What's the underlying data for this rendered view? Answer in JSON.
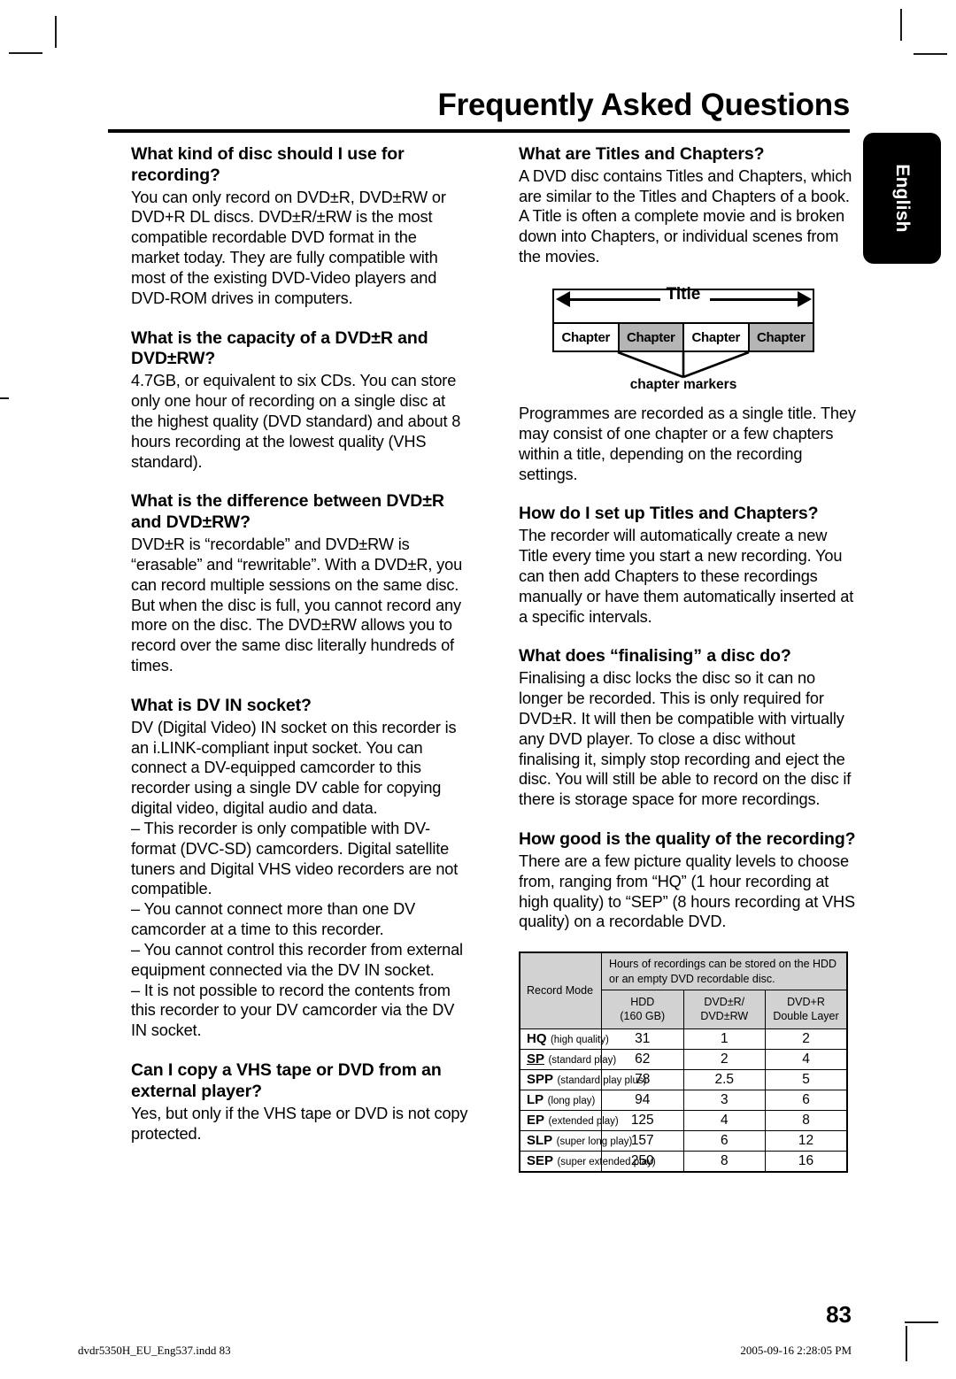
{
  "header": {
    "title": "Frequently Asked Questions",
    "language_tab": "English"
  },
  "left_column": {
    "sections": [
      {
        "question": "What kind of disc should I use for recording?",
        "answer": "You can only record on DVD±R, DVD±RW or DVD+R DL discs. DVD±R/±RW is the most compatible recordable DVD format in the market today. They are fully compatible with most of the existing DVD-Video players and DVD-ROM drives in computers."
      },
      {
        "question": "What is the capacity of a DVD±R and DVD±RW?",
        "answer": "4.7GB, or equivalent to six CDs. You can store only one hour of recording on a single disc at the highest quality (DVD standard) and about 8 hours recording at the lowest quality (VHS standard)."
      },
      {
        "question": "What is the difference between DVD±R and DVD±RW?",
        "answer": "DVD±R is “recordable” and DVD±RW is “erasable” and “rewritable”. With a DVD±R, you can record multiple sessions on the same disc. But when the disc is full, you cannot record any more on the disc. The DVD±RW allows you to record over the same disc literally hundreds of times."
      },
      {
        "question": "What is DV IN socket?",
        "answer": "DV (Digital Video) IN socket on this recorder is an i.LINK-compliant input socket. You can connect a DV-equipped camcorder to this recorder using a single DV cable for copying digital video, digital audio and data.",
        "dashes": [
          "–  This recorder is only compatible with DV-format (DVC-SD) camcorders. Digital satellite tuners and Digital VHS video recorders are not compatible.",
          "–  You cannot connect more than one DV camcorder at a time to this recorder.",
          "–  You cannot control this recorder from external equipment connected via the DV IN socket.",
          "–  It is not possible to record the contents from this recorder to your DV camcorder via the DV IN socket."
        ]
      },
      {
        "question": "Can I copy a VHS tape or DVD from an external player?",
        "answer": "Yes, but only if the VHS tape or DVD is not copy protected."
      }
    ]
  },
  "right_column": {
    "sections": [
      {
        "question": "What are Titles and Chapters?",
        "answer": "A DVD disc contains Titles and Chapters, which are similar to the Titles and Chapters of a book.  A Title is often a complete movie and is broken down into Chapters, or individual scenes from the movies."
      },
      {
        "answer": "Programmes are recorded as a single title. They may consist of one chapter or a few chapters within a title, depending on the recording settings."
      },
      {
        "question": "How do I set up Titles and Chapters?",
        "answer": "The recorder will automatically create a new Title every time you start a new recording. You can then add Chapters to these recordings manually or have them automatically inserted at a specific intervals."
      },
      {
        "question": "What does “finalising” a disc do?",
        "answer": "Finalising a disc locks the disc so it can no longer be recorded. This is only required for DVD±R. It will then be compatible with virtually any DVD player. To close a disc without finalising it, simply stop recording and eject the disc. You will still be able to record on the disc if there is storage space for more recordings."
      },
      {
        "question": "How good is the quality of the recording?",
        "answer": "There are a few picture quality levels to choose from, ranging from “HQ” (1 hour recording at high quality) to “SEP” (8 hours recording at VHS quality) on a recordable DVD."
      }
    ]
  },
  "diagram": {
    "title_label": "Title",
    "chapters": [
      "Chapter",
      "Chapter",
      "Chapter",
      "Chapter"
    ],
    "markers_label": "chapter markers"
  },
  "record_table": {
    "col_record_mode": "Record Mode",
    "col_hours_header": "Hours of recordings can be stored on the HDD or an empty DVD recordable disc.",
    "subheaders": [
      "HDD\n(160 GB)",
      "DVD±R/\nDVD±RW",
      "DVD+R\nDouble Layer"
    ],
    "sub_hdd_line1": "HDD",
    "sub_hdd_line2": "(160 GB)",
    "sub_dvdr_line1": "DVD±R/",
    "sub_dvdr_line2": "DVD±RW",
    "sub_dl_line1": "DVD+R",
    "sub_dl_line2": "Double Layer",
    "rows": [
      {
        "abbr": "HQ",
        "full": "(high quality)",
        "hdd": "31",
        "dvd": "1",
        "dl": "2",
        "underline": false
      },
      {
        "abbr": "SP",
        "full": "(standard play)",
        "hdd": "62",
        "dvd": "2",
        "dl": "4",
        "underline": true
      },
      {
        "abbr": "SPP",
        "full": "(standard play plus)",
        "hdd": "78",
        "dvd": "2.5",
        "dl": "5",
        "underline": false
      },
      {
        "abbr": "LP",
        "full": "(long play)",
        "hdd": "94",
        "dvd": "3",
        "dl": "6",
        "underline": false
      },
      {
        "abbr": "EP",
        "full": "(extended play)",
        "hdd": "125",
        "dvd": "4",
        "dl": "8",
        "underline": false
      },
      {
        "abbr": "SLP",
        "full": "(super long play)",
        "hdd": "157",
        "dvd": "6",
        "dl": "12",
        "underline": false
      },
      {
        "abbr": "SEP",
        "full": "(super extended play)",
        "hdd": "250",
        "dvd": "8",
        "dl": "16",
        "underline": false
      }
    ]
  },
  "page_number": "83",
  "footer": {
    "left": "dvdr5350H_EU_Eng537.indd   83",
    "right": "2005-09-16   2:28:05 PM"
  }
}
